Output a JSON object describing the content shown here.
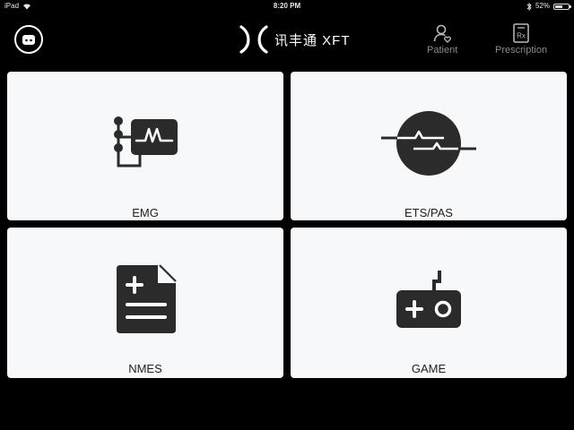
{
  "status_bar": {
    "device": "iPad",
    "time": "8:20 PM",
    "battery": "52%",
    "battery_level": 0.52
  },
  "header": {
    "logo_text": "讯丰通 XFT",
    "patient_label": "Patient",
    "prescription_label": "Prescription"
  },
  "modules": [
    {
      "label": "EMG",
      "icon": "emg-monitor-icon"
    },
    {
      "label": "ETS/PAS",
      "icon": "pulse-circle-icon"
    },
    {
      "label": "NMES",
      "icon": "document-plus-icon"
    },
    {
      "label": "GAME",
      "icon": "gamepad-icon"
    }
  ],
  "colors": {
    "background": "#000000",
    "card": "#f7f8f9",
    "icon": "#2b2b2b",
    "nav_label": "#8a8a8a"
  }
}
